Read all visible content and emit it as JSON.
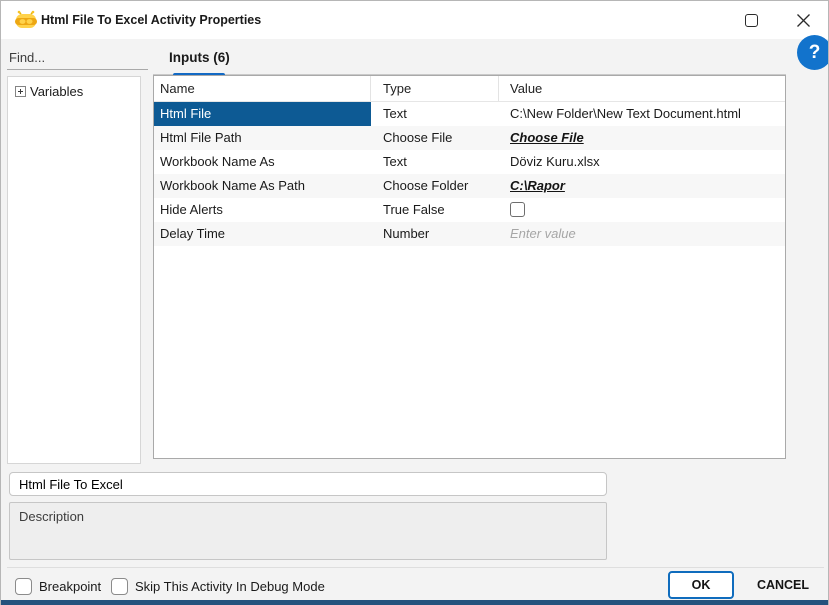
{
  "window": {
    "title": "Html File To Excel Activity Properties",
    "icons": {
      "app": "bee-robot-icon",
      "maximize": "maximize-icon",
      "close": "close-icon",
      "help": "?"
    }
  },
  "sidebar": {
    "find_placeholder": "Find...",
    "tree": [
      {
        "label": "Variables",
        "expanded": false
      }
    ]
  },
  "tabs": [
    {
      "label": "Inputs (6)",
      "active": true
    }
  ],
  "table": {
    "columns": [
      "Name",
      "Type",
      "Value"
    ],
    "rows": [
      {
        "name": "Html File",
        "type": "Text",
        "value": "C:\\New Folder\\New Text Document.html",
        "value_kind": "text",
        "selected": true
      },
      {
        "name": "Html File Path",
        "type": "Choose File",
        "value": "Choose File",
        "value_kind": "link",
        "selected": false
      },
      {
        "name": "Workbook Name As",
        "type": "Text",
        "value": "Döviz Kuru.xlsx",
        "value_kind": "text",
        "selected": false
      },
      {
        "name": "Workbook Name As Path",
        "type": "Choose Folder",
        "value": "C:\\Rapor",
        "value_kind": "link",
        "selected": false
      },
      {
        "name": "Hide Alerts",
        "type": "True False",
        "value": "",
        "value_kind": "checkbox",
        "checked": false,
        "selected": false
      },
      {
        "name": "Delay Time",
        "type": "Number",
        "value": "Enter value",
        "value_kind": "placeholder",
        "selected": false
      }
    ]
  },
  "name_input": {
    "value": "Html File To Excel"
  },
  "description": {
    "placeholder": "Description"
  },
  "footer": {
    "breakpoint_label": "Breakpoint",
    "skip_label": "Skip This Activity In Debug Mode",
    "ok_label": "OK",
    "cancel_label": "CANCEL"
  },
  "colors": {
    "selected_row": "#0d5a94",
    "tab_indicator": "#1269c4",
    "ok_border": "#0f6cbd",
    "help_circle": "#1273cc",
    "bottom_strip": "#24527d",
    "dialog_bg": "#f3f3f3"
  }
}
